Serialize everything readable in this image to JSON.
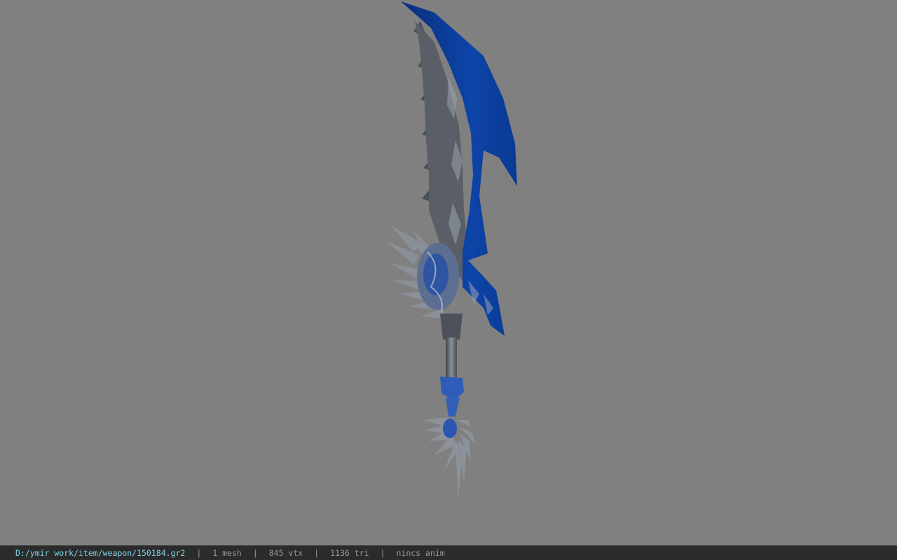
{
  "viewport": {
    "background_color": "#808080",
    "model": {
      "name": "weapon-model",
      "blade_color": "#0a3d9c",
      "metal_color": "#6e747c"
    }
  },
  "statusbar": {
    "path": "D:/ymir work/item/weapon/150184.gr2",
    "mesh": "1 mesh",
    "vtx": "845 vtx",
    "tri": "1136 tri",
    "anim": "nincs anim",
    "separator": "|",
    "path_color": "#7fd4ea"
  }
}
